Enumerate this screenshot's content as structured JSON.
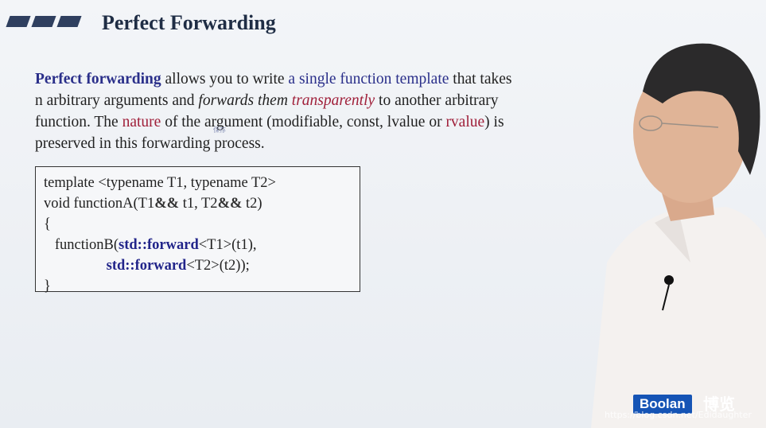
{
  "slide": {
    "title": "Perfect Forwarding",
    "paragraph": {
      "seg1": "Perfect forwarding",
      "seg2": " allows you to write ",
      "seg3": "a single function template",
      "seg4": " that takes n arbitrary arguments and ",
      "seg5": "forwards them",
      "seg6": " ",
      "seg7": "transparently",
      "seg8": " to another arbitrary function. The ",
      "seg9": "nature",
      "seg10": " of the argument (modifiable, const, lvalue or ",
      "seg11": "rvalue",
      "seg12": ") is preserved in this forwarding process."
    },
    "annotation": "保存",
    "code": {
      "l1": "template <typename T1, typename T2>",
      "l2a": "void functionA(T1",
      "l2b": "&&",
      "l2c": " t1, T2",
      "l2d": "&&",
      "l2e": " t2)",
      "l3": "{",
      "l4a": "   functionB(",
      "l4b": "std::forward",
      "l4c": "<T1>(t1),",
      "l5a": "                 ",
      "l5b": "std::forward",
      "l5c": "<T2>(t2));",
      "l6": "}"
    }
  },
  "branding": {
    "logo": "Boolan",
    "logo_cn": "博览",
    "watermark": "https://blog.csdn.net/Edidaughter"
  },
  "colors": {
    "accent_blue": "#2a2f8a",
    "accent_red": "#a0203a",
    "logo_bg": "#1554b5"
  }
}
